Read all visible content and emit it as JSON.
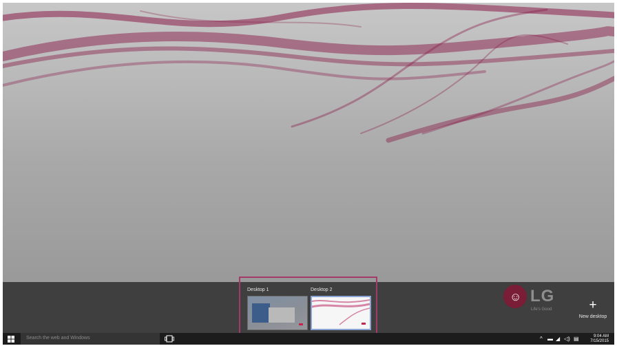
{
  "desktops": [
    {
      "label": "Desktop 1"
    },
    {
      "label": "Desktop 2"
    }
  ],
  "new_desktop": {
    "label": "New desktop",
    "icon": "plus-icon"
  },
  "brand": {
    "logo_text": "LG",
    "tagline": "Life's Good"
  },
  "taskbar": {
    "search_placeholder": "Search the web and Windows",
    "time": "9:04 AM",
    "date": "7/15/2015"
  },
  "colors": {
    "accent_highlight": "#a23b6a",
    "wallpaper_ribbon": "#8a1e4a",
    "taskbar": "#1c1c1c",
    "task_view_strip": "#3f3f3f"
  }
}
